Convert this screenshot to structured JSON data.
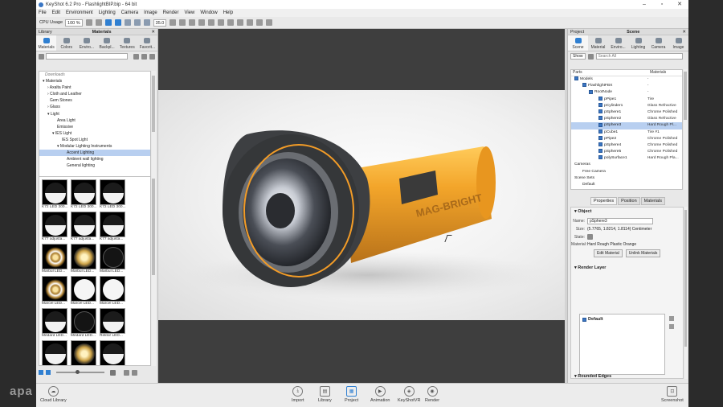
{
  "app": {
    "title": "KeyShot 6.2 Pro - FlashlightBIP.bip - 64 bit"
  },
  "menu": [
    "File",
    "Edit",
    "Environment",
    "Lighting",
    "Camera",
    "Image",
    "Render",
    "View",
    "Window",
    "Help"
  ],
  "toolbar": {
    "cpu_label": "CPU Usage",
    "cpu_value": "100 %",
    "fov_value": "35.0"
  },
  "library": {
    "panel_title": "Library",
    "panel_subtitle": "Materials",
    "tabs": [
      "Materials",
      "Colors",
      "Enviro...",
      "Backpl...",
      "Textures",
      "Favorit..."
    ],
    "tree": [
      {
        "label": "Downloads",
        "indent": 3,
        "style": "dim"
      },
      {
        "label": "▾ Materials",
        "indent": 0
      },
      {
        "label": "› Axalta Paint",
        "indent": 6
      },
      {
        "label": "› Cloth and Leather",
        "indent": 6
      },
      {
        "label": "Gem Stones",
        "indent": 9
      },
      {
        "label": "› Glass",
        "indent": 6
      },
      {
        "label": "▾ Light",
        "indent": 6
      },
      {
        "label": "Area Light",
        "indent": 18
      },
      {
        "label": "Emissive",
        "indent": 18
      },
      {
        "label": "▾ IES Light",
        "indent": 12
      },
      {
        "label": "IES Spot Light",
        "indent": 24
      },
      {
        "label": "▾ Modular Lighting Instruments",
        "indent": 18
      },
      {
        "label": "Accent Lighting",
        "indent": 30,
        "style": "sel"
      },
      {
        "label": "Ambient wall lighting",
        "indent": 30
      },
      {
        "label": "General lighting",
        "indent": 30
      }
    ],
    "thumbs": [
      {
        "caption": "K72 LED 300...",
        "kind": "top"
      },
      {
        "caption": "K72 LED 300...",
        "kind": "top"
      },
      {
        "caption": "K72 LED 300...",
        "kind": "top"
      },
      {
        "caption": "K77 adjusta...",
        "kind": "top"
      },
      {
        "caption": "K77 adjusta...",
        "kind": "top"
      },
      {
        "caption": "K77 adjusta...",
        "kind": "top"
      },
      {
        "caption": "Marbul LED...",
        "kind": "pat"
      },
      {
        "caption": "Marbul LED...",
        "kind": "orn"
      },
      {
        "caption": "Marbul LED...",
        "kind": "dark"
      },
      {
        "caption": "Marcel LED...",
        "kind": "pat"
      },
      {
        "caption": "Marcel LED...",
        "kind": "plain"
      },
      {
        "caption": "Marcel LED...",
        "kind": "plain"
      },
      {
        "caption": "Médard LED...",
        "kind": "top"
      },
      {
        "caption": "Médard LED...",
        "kind": "dark"
      },
      {
        "caption": "Rektor LED...",
        "kind": "top"
      },
      {
        "caption": "",
        "kind": "top"
      },
      {
        "caption": "",
        "kind": "orn"
      },
      {
        "caption": "",
        "kind": "top"
      }
    ]
  },
  "viewport": {
    "label_text": "MAG-BRIGHT"
  },
  "project": {
    "panel_title": "Project",
    "panel_subtitle": "Scene",
    "tabs": [
      "Scene",
      "Material",
      "Enviro...",
      "Lighting",
      "Camera",
      "Image"
    ],
    "show_label": "Show",
    "search_placeholder": "Search All",
    "col_parts": "Parts",
    "col_materials": "Materials",
    "rows": [
      {
        "label": "Models",
        "indent": 4,
        "check": true,
        "mat": "-"
      },
      {
        "label": "FlashlightFBX",
        "indent": 14,
        "check": true,
        "mat": "-"
      },
      {
        "label": "RootNode",
        "indent": 22,
        "check": true,
        "mat": "-"
      },
      {
        "label": "pPipe1",
        "indent": 34,
        "check": true,
        "mat": "Tire"
      },
      {
        "label": "pCylinder1",
        "indent": 34,
        "check": true,
        "mat": "Glass Refractive"
      },
      {
        "label": "pSphere1",
        "indent": 34,
        "check": true,
        "mat": "Chrome Polished"
      },
      {
        "label": "pSphere2",
        "indent": 34,
        "check": true,
        "mat": "Glass Refractive"
      },
      {
        "label": "pSphere3",
        "indent": 34,
        "check": true,
        "mat": "Hard Rough Pl...",
        "sel": true
      },
      {
        "label": "pCube1",
        "indent": 34,
        "check": true,
        "mat": "Tire #1"
      },
      {
        "label": "pPipe2",
        "indent": 34,
        "check": true,
        "mat": "Chrome Polished"
      },
      {
        "label": "pSphere4",
        "indent": 34,
        "check": true,
        "mat": "Chrome Polished"
      },
      {
        "label": "pSphere5",
        "indent": 34,
        "check": true,
        "mat": "Chrome Polished"
      },
      {
        "label": "polySurface1",
        "indent": 34,
        "check": true,
        "mat": "Hard Rough Pla..."
      },
      {
        "label": "Cameras",
        "indent": 4,
        "check": false,
        "mat": ""
      },
      {
        "label": "Free Camera",
        "indent": 14,
        "check": false,
        "mat": ""
      },
      {
        "label": "Scene Sets",
        "indent": 4,
        "check": false,
        "mat": ""
      },
      {
        "label": "Default",
        "indent": 14,
        "check": false,
        "mat": ""
      }
    ],
    "prop_tabs": [
      "Properties",
      "Position",
      "Materials"
    ],
    "object_header": "Object",
    "name_label": "Name:",
    "name_value": "pSphere3",
    "size_label": "Size:",
    "size_value": "(5.7765, 1.8214, 1.8114) Centimeter",
    "state_label": "State:",
    "material_label": "Material:",
    "material_value": "Hard Rough Plastic Orange",
    "edit_material": "Edit Material",
    "unlink_materials": "Unlink Materials",
    "render_layer_header": "Render Layer",
    "layer_default": "Default",
    "rounded_edges_header": "Rounded Edges"
  },
  "bottom": {
    "cloud_library": "Cloud Library",
    "buttons": [
      "Import",
      "Library",
      "Project",
      "Animation",
      "KeyShotVR",
      "Render"
    ],
    "screenshot": "Screenshot"
  },
  "watermark": "apa"
}
